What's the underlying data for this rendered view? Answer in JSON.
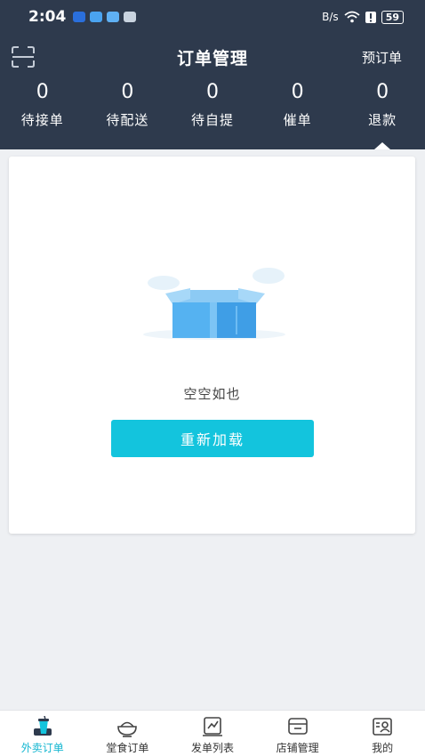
{
  "status_bar": {
    "time": "2:04",
    "network": "B/s",
    "battery": "59"
  },
  "header": {
    "title": "订单管理",
    "preorder_label": "预订单"
  },
  "stats": [
    {
      "count": "0",
      "label": "待接单"
    },
    {
      "count": "0",
      "label": "待配送"
    },
    {
      "count": "0",
      "label": "待自提"
    },
    {
      "count": "0",
      "label": "催单"
    },
    {
      "count": "0",
      "label": "退款"
    }
  ],
  "empty_state": {
    "text": "空空如也",
    "reload_label": "重新加载"
  },
  "bottom_nav": [
    {
      "label": "外卖订单",
      "icon": "takeout-cup-icon",
      "active": true
    },
    {
      "label": "堂食订单",
      "icon": "dine-in-bowl-icon",
      "active": false
    },
    {
      "label": "发单列表",
      "icon": "dispatch-list-icon",
      "active": false
    },
    {
      "label": "店铺管理",
      "icon": "store-icon",
      "active": false
    },
    {
      "label": "我的",
      "icon": "profile-card-icon",
      "active": false
    }
  ],
  "colors": {
    "header_bg": "#2e3a4d",
    "accent": "#13c4dd",
    "page_bg": "#eef0f3"
  }
}
